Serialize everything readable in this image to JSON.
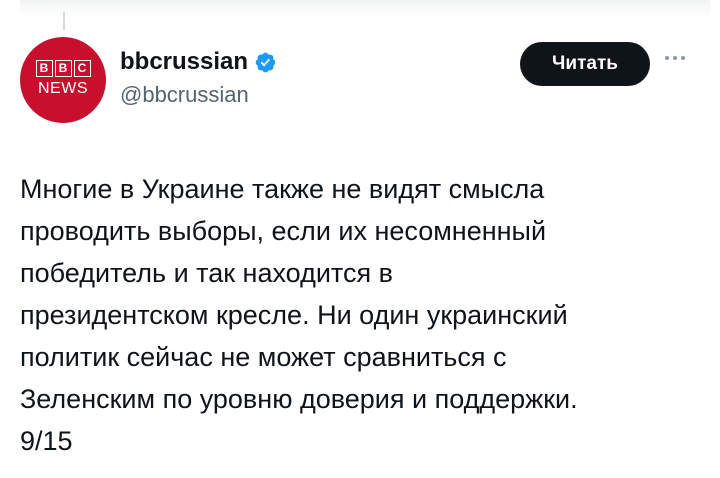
{
  "account": {
    "avatar_boxes": [
      "B",
      "B",
      "C"
    ],
    "avatar_news": "NEWS",
    "display_name": "bbcrussian",
    "handle": "@bbcrussian",
    "verified_icon": "verified-badge-icon",
    "avatar_color": "#c8102e",
    "verified_color": "#1d9bf0"
  },
  "actions": {
    "read_label": "Читать",
    "more_icon": "more-dots-icon"
  },
  "tweet": {
    "text": "Многие в Украине также не видят смысла\nпроводить выборы, если их несомненный\nпобедитель и так находится в\nпрезидентском кресле. Ни один украинский\nполитик сейчас не может сравниться с\nЗеленским по уровню доверия и поддержки.\n9/15"
  }
}
